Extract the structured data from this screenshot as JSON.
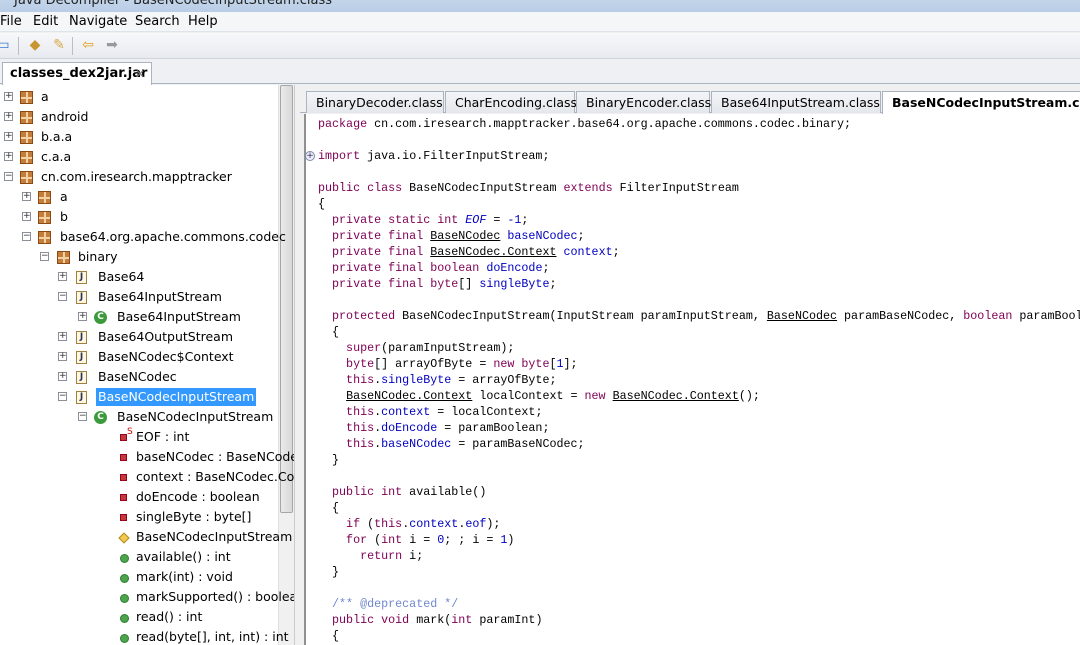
{
  "window": {
    "title": "Java Decompiler - BaseNCodecInputStream.class"
  },
  "menu": [
    "File",
    "Edit",
    "Navigate",
    "Search",
    "Help"
  ],
  "toolbar": {
    "icons": [
      "open-folder-icon",
      "open-type-icon",
      "search-icon",
      "back-arrow-icon",
      "forward-arrow-icon"
    ]
  },
  "file_tab": {
    "label": "classes_dex2jar.jar",
    "close": "✕"
  },
  "tree": [
    {
      "label": "a",
      "icon": "pkg",
      "level": 0,
      "exp": "+"
    },
    {
      "label": "android",
      "icon": "pkg",
      "level": 0,
      "exp": "+"
    },
    {
      "label": "b.a.a",
      "icon": "pkg",
      "level": 0,
      "exp": "+"
    },
    {
      "label": "c.a.a",
      "icon": "pkg",
      "level": 0,
      "exp": "+"
    },
    {
      "label": "cn.com.iresearch.mapptracker",
      "icon": "pkg",
      "level": 0,
      "exp": "−"
    },
    {
      "label": "a",
      "icon": "pkg",
      "level": 1,
      "exp": "+"
    },
    {
      "label": "b",
      "icon": "pkg",
      "level": 1,
      "exp": "+"
    },
    {
      "label": "base64.org.apache.commons.codec",
      "icon": "pkg",
      "level": 1,
      "exp": "−"
    },
    {
      "label": "binary",
      "icon": "pkg",
      "level": 2,
      "exp": "−"
    },
    {
      "label": "Base64",
      "icon": "jf",
      "level": 3,
      "exp": "+"
    },
    {
      "label": "Base64InputStream",
      "icon": "jf",
      "level": 3,
      "exp": "−"
    },
    {
      "label": "Base64InputStream",
      "icon": "cl",
      "level": 4,
      "exp": "+"
    },
    {
      "label": "Base64OutputStream",
      "icon": "jf",
      "level": 3,
      "exp": "+"
    },
    {
      "label": "BaseNCodec$Context",
      "icon": "jf",
      "level": 3,
      "exp": "+"
    },
    {
      "label": "BaseNCodec",
      "icon": "jf",
      "level": 3,
      "exp": "+"
    },
    {
      "label": "BaseNCodecInputStream",
      "icon": "jf",
      "level": 3,
      "exp": "−",
      "selected": true
    },
    {
      "label": "BaseNCodecInputStream",
      "icon": "cl",
      "level": 4,
      "exp": "−"
    },
    {
      "label": "EOF : int",
      "icon": "fld",
      "level": 5,
      "static": true
    },
    {
      "label": "baseNCodec : BaseNCodec",
      "icon": "fld",
      "level": 5
    },
    {
      "label": "context : BaseNCodec.Context",
      "icon": "fld",
      "level": 5
    },
    {
      "label": "doEncode : boolean",
      "icon": "fld",
      "level": 5
    },
    {
      "label": "singleByte : byte[]",
      "icon": "fld",
      "level": 5
    },
    {
      "label": "BaseNCodecInputStream",
      "icon": "ctor",
      "level": 5
    },
    {
      "label": "available() : int",
      "icon": "mth",
      "level": 5
    },
    {
      "label": "mark(int) : void",
      "icon": "mth",
      "level": 5
    },
    {
      "label": "markSupported() : boolean",
      "icon": "mth",
      "level": 5
    },
    {
      "label": "read() : int",
      "icon": "mth",
      "level": 5
    },
    {
      "label": "read(byte[], int, int) : int",
      "icon": "mth",
      "level": 5
    }
  ],
  "editor_tabs": [
    {
      "label": "BinaryDecoder.class"
    },
    {
      "label": "CharEncoding.class"
    },
    {
      "label": "BinaryEncoder.class"
    },
    {
      "label": "Base64InputStream.class"
    },
    {
      "label": "BaseNCodecInputStream.class",
      "active": true
    }
  ],
  "colors": {
    "keyword": "#7f0055",
    "field": "#0000c0",
    "comment": "#3f5fbf",
    "selection": "#3399ff"
  },
  "code": [
    [
      [
        "package",
        "k"
      ],
      [
        " cn.com.iresearch.mapptracker.base64.org.apache.commons.codec.binary;",
        ""
      ]
    ],
    [],
    [
      [
        "import",
        "k"
      ],
      [
        " java.io.FilterInputStream;",
        ""
      ]
    ],
    [],
    [
      [
        "public class",
        "k"
      ],
      [
        " BaseNCodecInputStream ",
        ""
      ],
      [
        "extends",
        "k"
      ],
      [
        " FilterInputStream",
        ""
      ]
    ],
    [
      [
        "{",
        ""
      ]
    ],
    [
      [
        "  private static int",
        "k"
      ],
      [
        " ",
        ""
      ],
      [
        "EOF",
        "fi"
      ],
      [
        " = ",
        ""
      ],
      [
        "-1",
        "n"
      ],
      [
        ";",
        ""
      ]
    ],
    [
      [
        "  private final",
        "k"
      ],
      [
        " ",
        ""
      ],
      [
        "BaseNCodec",
        "u"
      ],
      [
        " ",
        ""
      ],
      [
        "baseNCodec",
        "f"
      ],
      [
        ";",
        ""
      ]
    ],
    [
      [
        "  private final",
        "k"
      ],
      [
        " ",
        ""
      ],
      [
        "BaseNCodec.Context",
        "u"
      ],
      [
        " ",
        ""
      ],
      [
        "context",
        "f"
      ],
      [
        ";",
        ""
      ]
    ],
    [
      [
        "  private final boolean",
        "k"
      ],
      [
        " ",
        ""
      ],
      [
        "doEncode",
        "f"
      ],
      [
        ";",
        ""
      ]
    ],
    [
      [
        "  private final byte",
        "k"
      ],
      [
        "[] ",
        ""
      ],
      [
        "singleByte",
        "f"
      ],
      [
        ";",
        ""
      ]
    ],
    [],
    [
      [
        "  protected",
        "k"
      ],
      [
        " BaseNCodecInputStream(InputStream paramInputStream, ",
        ""
      ],
      [
        "BaseNCodec",
        "u"
      ],
      [
        " paramBaseNCodec, ",
        ""
      ],
      [
        "boolean",
        "k"
      ],
      [
        " paramBoolean)",
        ""
      ]
    ],
    [
      [
        "  {",
        ""
      ]
    ],
    [
      [
        "    super",
        "k"
      ],
      [
        "(paramInputStream);",
        ""
      ]
    ],
    [
      [
        "    byte",
        "k"
      ],
      [
        "[] arrayOfByte = ",
        ""
      ],
      [
        "new byte",
        "k"
      ],
      [
        "[",
        ""
      ],
      [
        "1",
        "n"
      ],
      [
        "];",
        ""
      ]
    ],
    [
      [
        "    this",
        "k"
      ],
      [
        ".",
        ""
      ],
      [
        "singleByte",
        "f"
      ],
      [
        " = arrayOfByte;",
        ""
      ]
    ],
    [
      [
        "    ",
        ""
      ],
      [
        "BaseNCodec.Context",
        "u"
      ],
      [
        " localContext = ",
        ""
      ],
      [
        "new",
        "k"
      ],
      [
        " ",
        ""
      ],
      [
        "BaseNCodec.Context",
        "u"
      ],
      [
        "();",
        ""
      ]
    ],
    [
      [
        "    this",
        "k"
      ],
      [
        ".",
        ""
      ],
      [
        "context",
        "f"
      ],
      [
        " = localContext;",
        ""
      ]
    ],
    [
      [
        "    this",
        "k"
      ],
      [
        ".",
        ""
      ],
      [
        "doEncode",
        "f"
      ],
      [
        " = paramBoolean;",
        ""
      ]
    ],
    [
      [
        "    this",
        "k"
      ],
      [
        ".",
        ""
      ],
      [
        "baseNCodec",
        "f"
      ],
      [
        " = paramBaseNCodec;",
        ""
      ]
    ],
    [
      [
        "  }",
        ""
      ]
    ],
    [],
    [
      [
        "  public int",
        "k"
      ],
      [
        " available()",
        ""
      ]
    ],
    [
      [
        "  {",
        ""
      ]
    ],
    [
      [
        "    if",
        "k"
      ],
      [
        " (",
        ""
      ],
      [
        "this",
        "k"
      ],
      [
        ".",
        ""
      ],
      [
        "context",
        "f"
      ],
      [
        ".",
        ""
      ],
      [
        "eof",
        "f"
      ],
      [
        ");",
        ""
      ]
    ],
    [
      [
        "    for",
        "k"
      ],
      [
        " (",
        ""
      ],
      [
        "int",
        "k"
      ],
      [
        " i = ",
        ""
      ],
      [
        "0",
        "n"
      ],
      [
        "; ; i = ",
        ""
      ],
      [
        "1",
        "n"
      ],
      [
        ")",
        ""
      ]
    ],
    [
      [
        "      return",
        "k"
      ],
      [
        " i;",
        ""
      ]
    ],
    [
      [
        "  }",
        ""
      ]
    ],
    [],
    [
      [
        "  /** @deprecated */",
        "c"
      ]
    ],
    [
      [
        "  public void",
        "k"
      ],
      [
        " mark(",
        ""
      ],
      [
        "int",
        "k"
      ],
      [
        " paramInt)",
        ""
      ]
    ],
    [
      [
        "  {",
        ""
      ]
    ]
  ]
}
